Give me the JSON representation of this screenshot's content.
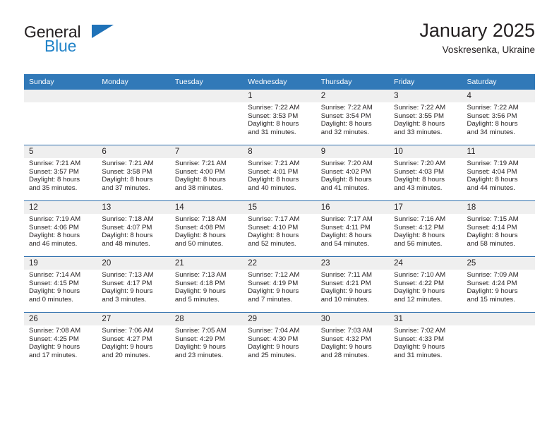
{
  "brand": {
    "name_part1": "General",
    "name_part2": "Blue",
    "logo_icon": "triangle-icon"
  },
  "header": {
    "title": "January 2025",
    "subtitle": "Voskresenka, Ukraine"
  },
  "weekday_headers": [
    "Sunday",
    "Monday",
    "Tuesday",
    "Wednesday",
    "Thursday",
    "Friday",
    "Saturday"
  ],
  "labels": {
    "sunrise_prefix": "Sunrise: ",
    "sunset_prefix": "Sunset: ",
    "daylight_prefix": "Daylight: "
  },
  "colors": {
    "header_blue": "#3179b8",
    "row_divider_blue": "#2f6fad",
    "day_shade_gray": "#efefef",
    "brand_blue": "#2283c8",
    "text": "#231f20"
  },
  "weeks": [
    [
      {
        "day": "",
        "empty": true
      },
      {
        "day": "",
        "empty": true
      },
      {
        "day": "",
        "empty": true
      },
      {
        "day": "1",
        "sunrise": "Sunrise: 7:22 AM",
        "sunset": "Sunset: 3:53 PM",
        "daylight_line1": "Daylight: 8 hours",
        "daylight_line2": "and 31 minutes."
      },
      {
        "day": "2",
        "sunrise": "Sunrise: 7:22 AM",
        "sunset": "Sunset: 3:54 PM",
        "daylight_line1": "Daylight: 8 hours",
        "daylight_line2": "and 32 minutes."
      },
      {
        "day": "3",
        "sunrise": "Sunrise: 7:22 AM",
        "sunset": "Sunset: 3:55 PM",
        "daylight_line1": "Daylight: 8 hours",
        "daylight_line2": "and 33 minutes."
      },
      {
        "day": "4",
        "sunrise": "Sunrise: 7:22 AM",
        "sunset": "Sunset: 3:56 PM",
        "daylight_line1": "Daylight: 8 hours",
        "daylight_line2": "and 34 minutes."
      }
    ],
    [
      {
        "day": "5",
        "sunrise": "Sunrise: 7:21 AM",
        "sunset": "Sunset: 3:57 PM",
        "daylight_line1": "Daylight: 8 hours",
        "daylight_line2": "and 35 minutes."
      },
      {
        "day": "6",
        "sunrise": "Sunrise: 7:21 AM",
        "sunset": "Sunset: 3:58 PM",
        "daylight_line1": "Daylight: 8 hours",
        "daylight_line2": "and 37 minutes."
      },
      {
        "day": "7",
        "sunrise": "Sunrise: 7:21 AM",
        "sunset": "Sunset: 4:00 PM",
        "daylight_line1": "Daylight: 8 hours",
        "daylight_line2": "and 38 minutes."
      },
      {
        "day": "8",
        "sunrise": "Sunrise: 7:21 AM",
        "sunset": "Sunset: 4:01 PM",
        "daylight_line1": "Daylight: 8 hours",
        "daylight_line2": "and 40 minutes."
      },
      {
        "day": "9",
        "sunrise": "Sunrise: 7:20 AM",
        "sunset": "Sunset: 4:02 PM",
        "daylight_line1": "Daylight: 8 hours",
        "daylight_line2": "and 41 minutes."
      },
      {
        "day": "10",
        "sunrise": "Sunrise: 7:20 AM",
        "sunset": "Sunset: 4:03 PM",
        "daylight_line1": "Daylight: 8 hours",
        "daylight_line2": "and 43 minutes."
      },
      {
        "day": "11",
        "sunrise": "Sunrise: 7:19 AM",
        "sunset": "Sunset: 4:04 PM",
        "daylight_line1": "Daylight: 8 hours",
        "daylight_line2": "and 44 minutes."
      }
    ],
    [
      {
        "day": "12",
        "sunrise": "Sunrise: 7:19 AM",
        "sunset": "Sunset: 4:06 PM",
        "daylight_line1": "Daylight: 8 hours",
        "daylight_line2": "and 46 minutes."
      },
      {
        "day": "13",
        "sunrise": "Sunrise: 7:18 AM",
        "sunset": "Sunset: 4:07 PM",
        "daylight_line1": "Daylight: 8 hours",
        "daylight_line2": "and 48 minutes."
      },
      {
        "day": "14",
        "sunrise": "Sunrise: 7:18 AM",
        "sunset": "Sunset: 4:08 PM",
        "daylight_line1": "Daylight: 8 hours",
        "daylight_line2": "and 50 minutes."
      },
      {
        "day": "15",
        "sunrise": "Sunrise: 7:17 AM",
        "sunset": "Sunset: 4:10 PM",
        "daylight_line1": "Daylight: 8 hours",
        "daylight_line2": "and 52 minutes."
      },
      {
        "day": "16",
        "sunrise": "Sunrise: 7:17 AM",
        "sunset": "Sunset: 4:11 PM",
        "daylight_line1": "Daylight: 8 hours",
        "daylight_line2": "and 54 minutes."
      },
      {
        "day": "17",
        "sunrise": "Sunrise: 7:16 AM",
        "sunset": "Sunset: 4:12 PM",
        "daylight_line1": "Daylight: 8 hours",
        "daylight_line2": "and 56 minutes."
      },
      {
        "day": "18",
        "sunrise": "Sunrise: 7:15 AM",
        "sunset": "Sunset: 4:14 PM",
        "daylight_line1": "Daylight: 8 hours",
        "daylight_line2": "and 58 minutes."
      }
    ],
    [
      {
        "day": "19",
        "sunrise": "Sunrise: 7:14 AM",
        "sunset": "Sunset: 4:15 PM",
        "daylight_line1": "Daylight: 9 hours",
        "daylight_line2": "and 0 minutes."
      },
      {
        "day": "20",
        "sunrise": "Sunrise: 7:13 AM",
        "sunset": "Sunset: 4:17 PM",
        "daylight_line1": "Daylight: 9 hours",
        "daylight_line2": "and 3 minutes."
      },
      {
        "day": "21",
        "sunrise": "Sunrise: 7:13 AM",
        "sunset": "Sunset: 4:18 PM",
        "daylight_line1": "Daylight: 9 hours",
        "daylight_line2": "and 5 minutes."
      },
      {
        "day": "22",
        "sunrise": "Sunrise: 7:12 AM",
        "sunset": "Sunset: 4:19 PM",
        "daylight_line1": "Daylight: 9 hours",
        "daylight_line2": "and 7 minutes."
      },
      {
        "day": "23",
        "sunrise": "Sunrise: 7:11 AM",
        "sunset": "Sunset: 4:21 PM",
        "daylight_line1": "Daylight: 9 hours",
        "daylight_line2": "and 10 minutes."
      },
      {
        "day": "24",
        "sunrise": "Sunrise: 7:10 AM",
        "sunset": "Sunset: 4:22 PM",
        "daylight_line1": "Daylight: 9 hours",
        "daylight_line2": "and 12 minutes."
      },
      {
        "day": "25",
        "sunrise": "Sunrise: 7:09 AM",
        "sunset": "Sunset: 4:24 PM",
        "daylight_line1": "Daylight: 9 hours",
        "daylight_line2": "and 15 minutes."
      }
    ],
    [
      {
        "day": "26",
        "sunrise": "Sunrise: 7:08 AM",
        "sunset": "Sunset: 4:25 PM",
        "daylight_line1": "Daylight: 9 hours",
        "daylight_line2": "and 17 minutes."
      },
      {
        "day": "27",
        "sunrise": "Sunrise: 7:06 AM",
        "sunset": "Sunset: 4:27 PM",
        "daylight_line1": "Daylight: 9 hours",
        "daylight_line2": "and 20 minutes."
      },
      {
        "day": "28",
        "sunrise": "Sunrise: 7:05 AM",
        "sunset": "Sunset: 4:29 PM",
        "daylight_line1": "Daylight: 9 hours",
        "daylight_line2": "and 23 minutes."
      },
      {
        "day": "29",
        "sunrise": "Sunrise: 7:04 AM",
        "sunset": "Sunset: 4:30 PM",
        "daylight_line1": "Daylight: 9 hours",
        "daylight_line2": "and 25 minutes."
      },
      {
        "day": "30",
        "sunrise": "Sunrise: 7:03 AM",
        "sunset": "Sunset: 4:32 PM",
        "daylight_line1": "Daylight: 9 hours",
        "daylight_line2": "and 28 minutes."
      },
      {
        "day": "31",
        "sunrise": "Sunrise: 7:02 AM",
        "sunset": "Sunset: 4:33 PM",
        "daylight_line1": "Daylight: 9 hours",
        "daylight_line2": "and 31 minutes."
      },
      {
        "day": "",
        "empty": true
      }
    ]
  ]
}
